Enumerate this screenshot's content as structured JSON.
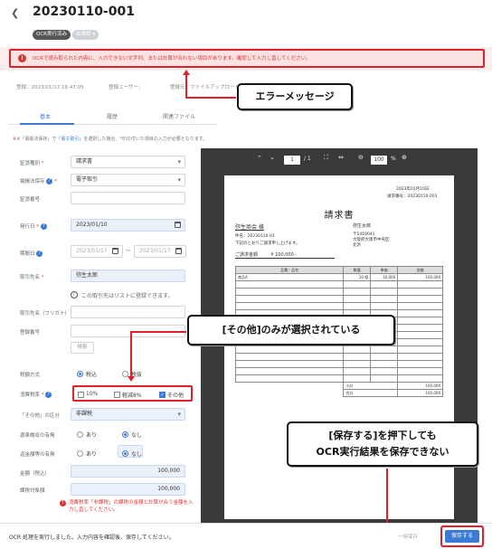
{
  "header": {
    "back_icon": "chevron-left-icon",
    "title": "20230110-001",
    "badge_ocr": "OCR実行済み",
    "badge_status": "未承認"
  },
  "error": {
    "message": "OCRで読み取られた内容に、入力できない文字列、または計算が合わない項目があります。確認して入力し直してください。"
  },
  "meta": {
    "registered": "登録：2023/01/17 16:47:05",
    "user": "登録ユーザー：",
    "source": "登録元：ファイルアップロード"
  },
  "tabs": [
    {
      "label": "基本"
    },
    {
      "label": "履歴"
    },
    {
      "label": "関連ファイル"
    }
  ],
  "note": {
    "prefix": "※「電帳法保存」で",
    "link": "「電子取引」",
    "suffix": "を選択した場合、*印の付いた項目の入力が必要となります。"
  },
  "form": {
    "doc_type_label": "証憑種別",
    "doc_type_value": "請求書",
    "storage_label": "電帳法保存",
    "storage_value": "電子取引",
    "doc_no_label": "証憑番号",
    "doc_no_value": "",
    "issue_date_label": "発行日",
    "issue_date_value": "2023/01/10",
    "period_label": "期間日",
    "period_from": "2023/01/17",
    "period_sep": "〜",
    "period_to": "2023/01/17",
    "partner_label": "取引先名",
    "partner_value": "弥生太郎",
    "partner_hint": "この取引先はリストに登録できます。",
    "partner_kana_label": "取引先名（フリガナ）",
    "partner_kana_value": "",
    "reg_no_label": "登録番号",
    "reg_no_value": "",
    "search_button": "検索",
    "tax_method_label": "税額方式",
    "tax_method_options": [
      "税込",
      "税抜"
    ],
    "tax_rate_label": "消費税率",
    "tax_rate_options": [
      "10%",
      "軽減8%",
      "その他"
    ],
    "other_label": "「その他」の区分",
    "other_value": "非課税",
    "withholding_label": "源泉徴収の有無",
    "withholding_options": [
      "あり",
      "なし"
    ],
    "discount_label": "返金額等の有無",
    "discount_options": [
      "あり",
      "なし"
    ],
    "amount_label": "金額（税込）",
    "amount_value": "100,000",
    "nontax_label": "課税対象額",
    "nontax_value": "100,000",
    "warning": "消費税率「非課税」の課税の金額と計算が合う金額を入力し直してください。"
  },
  "viewer": {
    "page_current": "1",
    "page_total": "/ 1",
    "zoom": "100",
    "zoom_unit": "%"
  },
  "invoice": {
    "date": "2023年01月10日",
    "number": "請求番号：20230110-001",
    "title": "請求書",
    "to": "弥生商会 様",
    "subject": "件名：20230110-01",
    "greeting": "下記のとおりご請求申し上げます。",
    "from_name": "弥生太郎",
    "from_addr1": "〒5410041",
    "from_addr2": "大阪府大阪市中央区",
    "from_addr3": "北浜",
    "total_label": "ご請求金額",
    "total_value": "¥ 100,000 -",
    "headers": [
      "品番・品名",
      "数量",
      "単価",
      "金額"
    ],
    "row1": [
      "商品A",
      "10 個",
      "10,000",
      "100,000"
    ],
    "subtotal_label": "小計",
    "subtotal_value": "100,000",
    "sum_label": "合計",
    "sum_value": "100,000"
  },
  "callouts": {
    "error_message": "エラーメッセージ",
    "other_only": "[その他]のみが選択されている",
    "cannot_save_1": "[保存する]を押下しても",
    "cannot_save_2": "OCR実行結果を保存できない"
  },
  "footer": {
    "status": "OCR 処理を実行しました。入力内容を確認後、保存してください。",
    "ghost": "一時保存",
    "save_label": "保存する"
  },
  "colors": {
    "accent": "#3b7bd6",
    "error": "#e0202a",
    "error_bg": "#fbe3e3"
  }
}
